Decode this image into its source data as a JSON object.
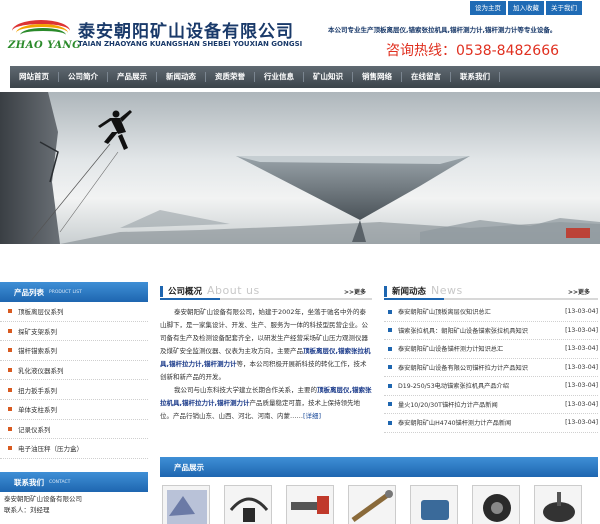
{
  "toplinks": [
    "设为主页",
    "加入收藏",
    "关于我们"
  ],
  "header": {
    "logo_text": "ZHAO YANG",
    "company_cn": "泰安朝阳矿山设备有限公司",
    "company_en": "TAIAN ZHAOYANG KUANGSHAN SHEBEI YOUXIAN GONGSI",
    "slogan": "本公司专业生产顶板离层仪,锚索张拉机具,锚杆测力计,锚杆测力计等专业设备。",
    "hotline": "咨询热线：0538-8482666"
  },
  "nav": [
    "网站首页",
    "公司简介",
    "产品展示",
    "新闻动态",
    "资质荣誉",
    "行业信息",
    "矿山知识",
    "销售网络",
    "在线留言",
    "联系我们"
  ],
  "product_list": {
    "title": "产品列表",
    "subtitle": "PRODUCT LIST",
    "items": [
      "顶板离层仪系列",
      "探矿支架系列",
      "锚杆锚索系列",
      "乳化液仪器系列",
      "扭力扳手系列",
      "单体支柱系列",
      "记录仪系列",
      "电子油压秤（压力盒）"
    ]
  },
  "contact": {
    "title": "联系我们",
    "subtitle": "CONTACT",
    "lines": [
      "泰安朝阳矿山设备有限公司",
      "联系人：刘经理"
    ]
  },
  "about": {
    "title": "公司概况",
    "title_en": "About us",
    "more": ">>更多",
    "p1_a": "泰安朝阳矿山设备有限公司，始建于2002年，坐落于驰名中外的泰山脚下，是一家集设计、开发、生产、服务为一体的科技型民营企业。公司备有生产及检测设备配套齐全，以研发生产经营采场矿山压力观测仪器及煤矿安全监测仪器、仪表为主攻方向，主要产品",
    "p1_b": "顶板离层仪,锚索张拉机具,锚杆拉力计,锚杆测力计",
    "p1_c": "等，本公司积极开展新科技的转化工作，技术创新和新产品的开发。",
    "p2_a": "我公司与山东科技大学建立长期合作关系，主要的",
    "p2_b": "顶板离层仪,锚索张拉机具,锚杆拉力计,锚杆测力计",
    "p2_c": "产品质量稳定可靠，技术上保持领先地位。产品行销山东、山西、河北、河南、内蒙……",
    "detail_link": "[详细]"
  },
  "news": {
    "title": "新闻动态",
    "title_en": "News",
    "more": ">>更多",
    "items": [
      {
        "title": "泰安朝阳矿山顶板离层仪知识总汇",
        "date": "[13-03-04]"
      },
      {
        "title": "锚索张拉机具：朝阳矿山设备锚索张拉机具知识",
        "date": "[13-03-04]"
      },
      {
        "title": "泰安朝阳矿山设备锚杆测力计知识总汇",
        "date": "[13-03-04]"
      },
      {
        "title": "泰安朝阳矿山设备有限公司锚杆拉力计产品知识",
        "date": "[13-03-04]"
      },
      {
        "title": "D19-250/53电动锚索张拉机具产品介绍",
        "date": "[13-03-04]"
      },
      {
        "title": "量火10/20/30T锚杆拉力计产品新闻",
        "date": "[13-03-04]"
      },
      {
        "title": "泰安朝阳矿山H4740锚杆测力计产品新闻",
        "date": "[13-03-04]"
      }
    ]
  },
  "products": {
    "title": "产品展示"
  },
  "colors": {
    "accent_blue": "#1e66b0",
    "hotline_red": "#e03020",
    "nav_dark": "#3b434a"
  }
}
